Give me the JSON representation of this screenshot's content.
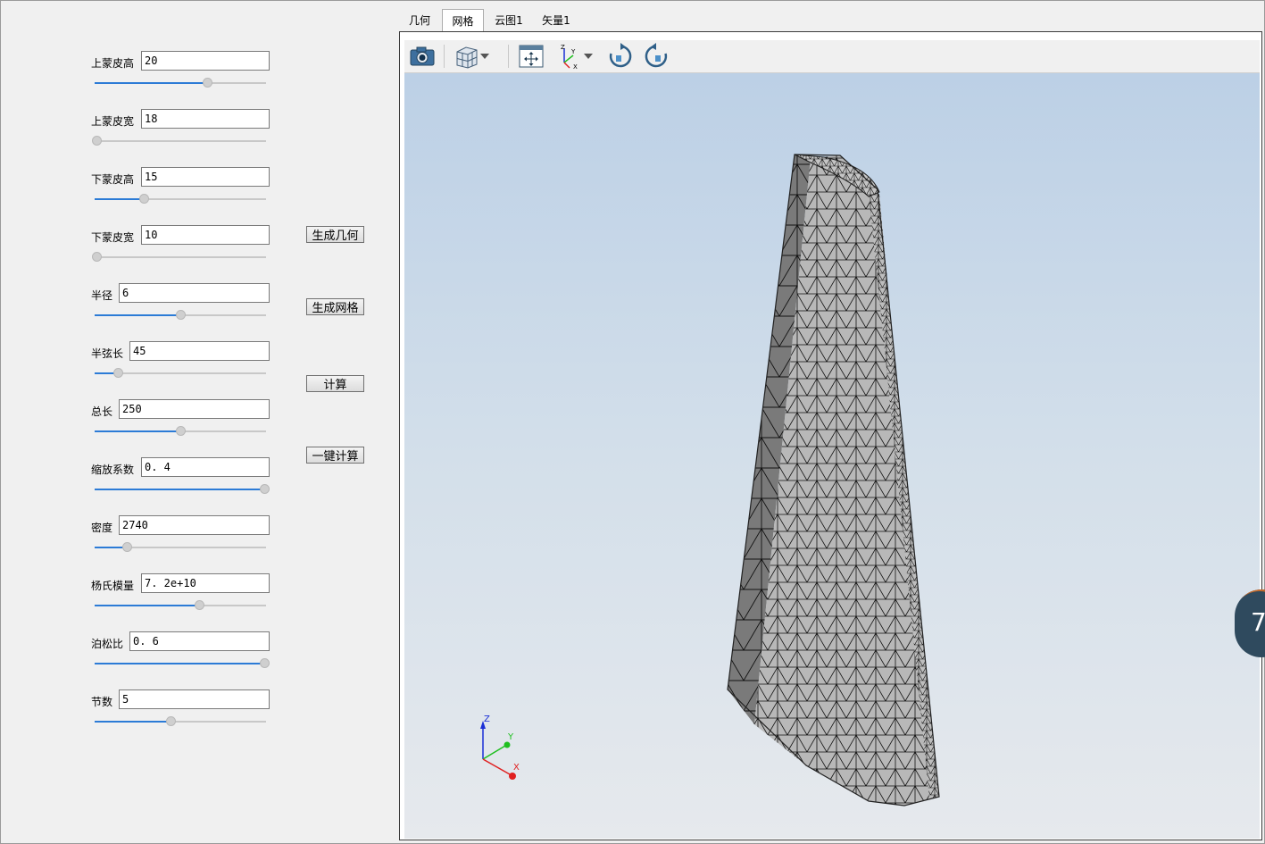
{
  "params": [
    {
      "label": "上蒙皮高",
      "value": "20",
      "slider": 0.66
    },
    {
      "label": "上蒙皮宽",
      "value": "18",
      "slider": 0.0
    },
    {
      "label": "下蒙皮高",
      "value": "15",
      "slider": 0.28
    },
    {
      "label": "下蒙皮宽",
      "value": "10",
      "slider": 0.0
    },
    {
      "label": "半径",
      "value": "6",
      "slider": 0.5
    },
    {
      "label": "半弦长",
      "value": "45",
      "slider": 0.13
    },
    {
      "label": "总长",
      "value": "250",
      "slider": 0.5
    },
    {
      "label": "缩放系数",
      "value": "0. 4",
      "slider": 1.0
    },
    {
      "label": "密度",
      "value": "2740",
      "slider": 0.18
    },
    {
      "label": "杨氏模量",
      "value": "7. 2e+10",
      "slider": 0.61
    },
    {
      "label": "泊松比",
      "value": "0. 6",
      "slider": 1.0
    },
    {
      "label": "节数",
      "value": "5",
      "slider": 0.44
    }
  ],
  "buttons": {
    "gen_geometry": "生成几何",
    "gen_mesh": "生成网格",
    "compute": "计算",
    "one_click": "一键计算"
  },
  "tabs": [
    {
      "label": "几何",
      "active": false
    },
    {
      "label": "网格",
      "active": true
    },
    {
      "label": "云图1",
      "active": false
    },
    {
      "label": "矢量1",
      "active": false
    }
  ],
  "toolbar": {
    "icons": [
      "camera-icon",
      "cube-view-icon",
      "dropdown-arrow-icon",
      "fit-all-icon",
      "axes-icon",
      "dropdown-arrow-icon",
      "rotate-cw-icon",
      "rotate-ccw-icon"
    ]
  },
  "triad": {
    "x": "X",
    "y": "Y",
    "z": "Z"
  },
  "triad_colors": {
    "x": "#e02020",
    "y": "#1fbf1f",
    "z": "#1a2fd6"
  },
  "side_badge": "7"
}
